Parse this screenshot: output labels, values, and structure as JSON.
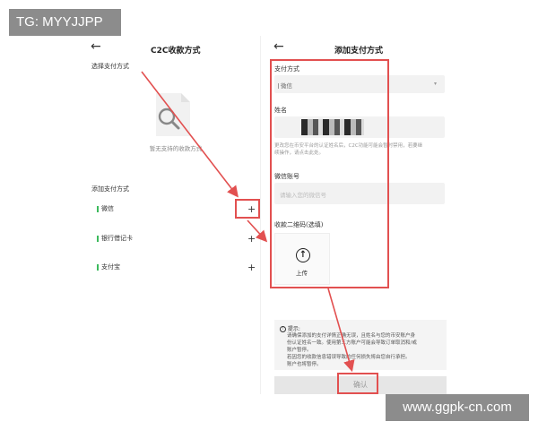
{
  "watermarks": {
    "top_left": "TG: MYYJJPP",
    "bottom_right": "www.ggpk-cn.com"
  },
  "left": {
    "back": "←",
    "title": "C2C收款方式",
    "select_label": "选择支付方式",
    "empty_text": "暂无支持的收款方式",
    "add_label": "添加支付方式",
    "methods": [
      {
        "label": "微信",
        "plus": "+"
      },
      {
        "label": "银行借记卡",
        "plus": "+"
      },
      {
        "label": "支付宝",
        "plus": "+"
      }
    ]
  },
  "right": {
    "back": "←",
    "title": "添加支付方式",
    "pay_method_label": "支付方式",
    "pay_method_value": "微信",
    "name_label": "姓名",
    "name_hint_line1": "更改您在币安平台的认证姓名后，C2C功能可能会暂时禁用，若要继",
    "name_hint_line2": "续操作，请点击此处。",
    "wechat_label": "微信账号",
    "wechat_placeholder": "请输入您的微信号",
    "qr_label": "收款二维码(选填)",
    "upload_icon": "↑",
    "upload_label": "上传",
    "tip_title": "提示:",
    "tip_lines": [
      "请确保添加的支付详情正确无误，且姓名与您的币安账户身",
      "份认证姓名一致。使用第三方账户可能会导致订单取消和/或",
      "账户暂停。",
      "若因您的收款信息错误导致的任何损失将由您自行承担。",
      "账户也将暂停。"
    ],
    "confirm": "确认"
  },
  "colors": {
    "annotation_red": "#e25050",
    "accent_green": "#3cba5d"
  }
}
